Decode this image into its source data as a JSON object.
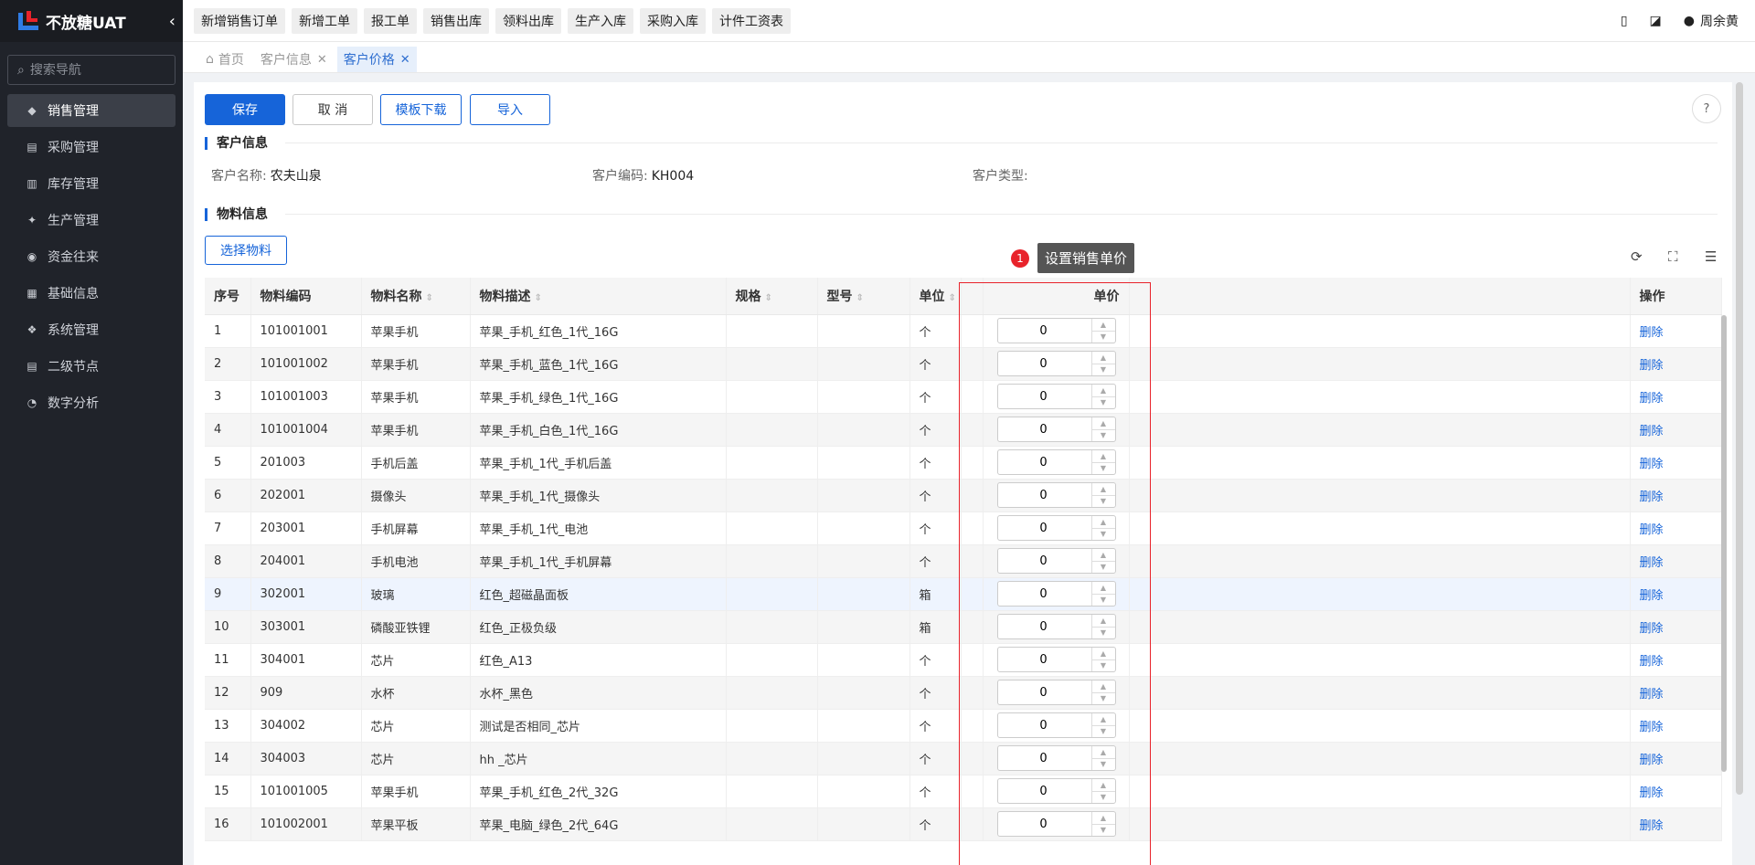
{
  "app": {
    "title": "不放糖UAT"
  },
  "sidebar": {
    "search_placeholder": "搜索导航",
    "items": [
      {
        "label": "销售管理",
        "icon": "tag-icon"
      },
      {
        "label": "采购管理",
        "icon": "cart-icon"
      },
      {
        "label": "库存管理",
        "icon": "warehouse-icon"
      },
      {
        "label": "生产管理",
        "icon": "production-icon"
      },
      {
        "label": "资金往来",
        "icon": "money-icon"
      },
      {
        "label": "基础信息",
        "icon": "grid-icon"
      },
      {
        "label": "系统管理",
        "icon": "settings-icon"
      },
      {
        "label": "二级节点",
        "icon": "list-icon"
      },
      {
        "label": "数字分析",
        "icon": "pie-icon"
      }
    ]
  },
  "toolbar": {
    "quick": [
      "新增销售订单",
      "新增工单",
      "报工单",
      "销售出库",
      "领料出库",
      "生产入库",
      "采购入库",
      "计件工资表"
    ],
    "user": "周余黄"
  },
  "tabs": [
    {
      "label": "首页"
    },
    {
      "label": "客户信息"
    },
    {
      "label": "客户价格"
    }
  ],
  "actions": {
    "save": "保存",
    "cancel": "取 消",
    "template": "模板下载",
    "import": "导入"
  },
  "customer_section": {
    "title": "客户信息",
    "name_label": "客户名称:",
    "name": "农夫山泉",
    "code_label": "客户编码:",
    "code": "KH004",
    "type_label": "客户类型:",
    "type": ""
  },
  "material_section": {
    "title": "物料信息",
    "select_button": "选择物料"
  },
  "tooltip": {
    "number": "1",
    "text": "设置销售单价"
  },
  "table": {
    "headers": {
      "seq": "序号",
      "code": "物料编码",
      "name": "物料名称",
      "desc": "物料描述",
      "spec": "规格",
      "model": "型号",
      "unit": "单位",
      "price": "单价",
      "ops": "操作"
    },
    "delete_label": "删除",
    "rows": [
      {
        "seq": "1",
        "code": "101001001",
        "name": "苹果手机",
        "desc": "苹果_手机_红色_1代_16G",
        "unit": "个",
        "price": "0"
      },
      {
        "seq": "2",
        "code": "101001002",
        "name": "苹果手机",
        "desc": "苹果_手机_蓝色_1代_16G",
        "unit": "个",
        "price": "0"
      },
      {
        "seq": "3",
        "code": "101001003",
        "name": "苹果手机",
        "desc": "苹果_手机_绿色_1代_16G",
        "unit": "个",
        "price": "0"
      },
      {
        "seq": "4",
        "code": "101001004",
        "name": "苹果手机",
        "desc": "苹果_手机_白色_1代_16G",
        "unit": "个",
        "price": "0"
      },
      {
        "seq": "5",
        "code": "201003",
        "name": "手机后盖",
        "desc": "苹果_手机_1代_手机后盖",
        "unit": "个",
        "price": "0"
      },
      {
        "seq": "6",
        "code": "202001",
        "name": "摄像头",
        "desc": "苹果_手机_1代_摄像头",
        "unit": "个",
        "price": "0"
      },
      {
        "seq": "7",
        "code": "203001",
        "name": "手机屏幕",
        "desc": "苹果_手机_1代_电池",
        "unit": "个",
        "price": "0"
      },
      {
        "seq": "8",
        "code": "204001",
        "name": "手机电池",
        "desc": "苹果_手机_1代_手机屏幕",
        "unit": "个",
        "price": "0"
      },
      {
        "seq": "9",
        "code": "302001",
        "name": "玻璃",
        "desc": "红色_超磁晶面板",
        "unit": "箱",
        "price": "0"
      },
      {
        "seq": "10",
        "code": "303001",
        "name": "磷酸亚铁锂",
        "desc": "红色_正极负级",
        "unit": "箱",
        "price": "0"
      },
      {
        "seq": "11",
        "code": "304001",
        "name": "芯片",
        "desc": "红色_A13",
        "unit": "个",
        "price": "0"
      },
      {
        "seq": "12",
        "code": "909",
        "name": "水杯",
        "desc": "水杯_黑色",
        "unit": "个",
        "price": "0"
      },
      {
        "seq": "13",
        "code": "304002",
        "name": "芯片",
        "desc": "测试是否相同_芯片",
        "unit": "个",
        "price": "0"
      },
      {
        "seq": "14",
        "code": "304003",
        "name": "芯片",
        "desc": "hh _芯片",
        "unit": "个",
        "price": "0"
      },
      {
        "seq": "15",
        "code": "101001005",
        "name": "苹果手机",
        "desc": "苹果_手机_红色_2代_32G",
        "unit": "个",
        "price": "0"
      },
      {
        "seq": "16",
        "code": "101002001",
        "name": "苹果平板",
        "desc": "苹果_电脑_绿色_2代_64G",
        "unit": "个",
        "price": "0"
      }
    ]
  },
  "colors": {
    "primary": "#1664d9",
    "sidebar_bg": "#20232a",
    "highlight": "#e8232b"
  }
}
